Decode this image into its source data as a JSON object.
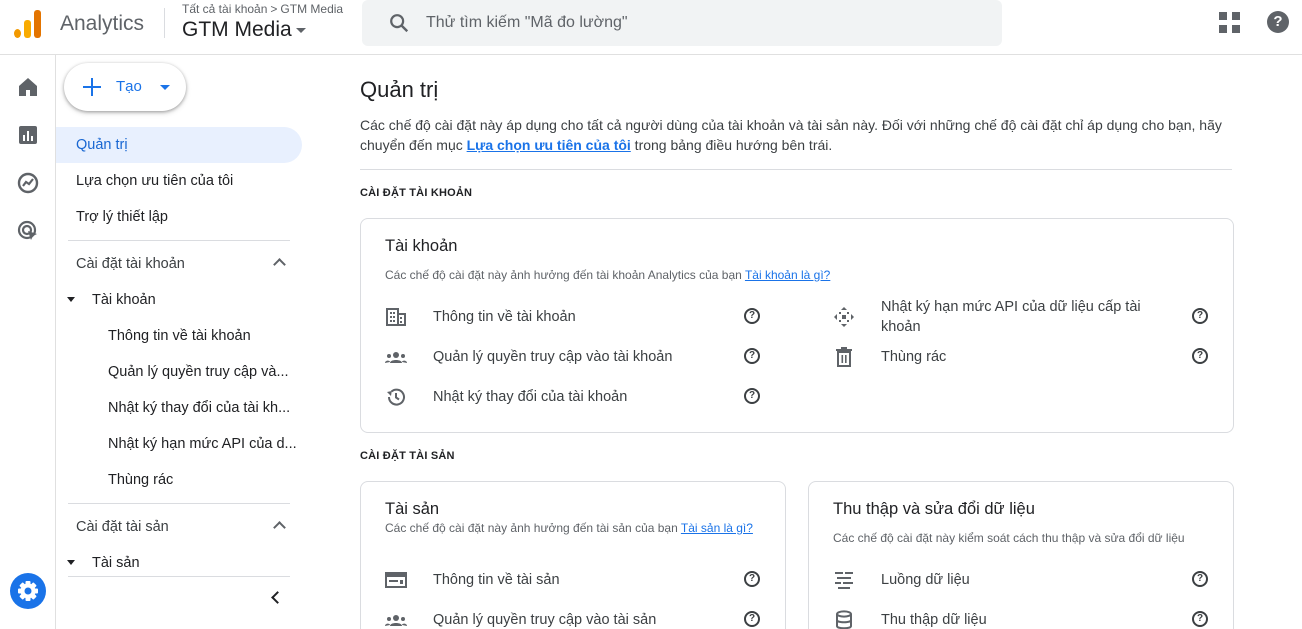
{
  "app": {
    "name": "Analytics"
  },
  "header": {
    "breadcrumb_root": "Tất cả tài khoản",
    "breadcrumb_sep": ">",
    "breadcrumb_account": "GTM Media",
    "account_name": "GTM Media",
    "search_placeholder": "Thử tìm kiếm \"Mã đo lường\"",
    "help_glyph": "?"
  },
  "sidebar": {
    "create_label": "Tạo",
    "items": [
      "Quản trị",
      "Lựa chọn ưu tiên của tôi",
      "Trợ lý thiết lập"
    ],
    "account_section": "Cài đặt tài khoản",
    "account_group": "Tài khoản",
    "account_leaves": [
      "Thông tin về tài khoản",
      "Quản lý quyền truy cập và...",
      "Nhật ký thay đổi của tài kh...",
      "Nhật ký hạn mức API của d...",
      "Thùng rác"
    ],
    "property_section": "Cài đặt tài sản",
    "property_group": "Tài sản"
  },
  "main": {
    "title": "Quản trị",
    "desc_before": "Các chế độ cài đặt này áp dụng cho tất cả người dùng của tài khoản và tài sản này. Đối với những chế độ cài đặt chỉ áp dụng cho bạn, hãy chuyển đến mục ",
    "desc_link": "Lựa chọn ưu tiên của tôi",
    "desc_after": " trong bảng điều hướng bên trái.",
    "account_settings_label": "CÀI ĐẶT TÀI KHOẢN",
    "property_settings_label": "CÀI ĐẶT TÀI SẢN",
    "account_card": {
      "title": "Tài khoản",
      "desc": "Các chế độ cài đặt này ảnh hưởng đến tài khoản Analytics của bạn ",
      "link": "Tài khoản là gì?",
      "rows": [
        "Thông tin về tài khoản",
        "Quản lý quyền truy cập vào tài khoản",
        "Nhật ký thay đổi của tài khoản",
        "Nhật ký hạn mức API của dữ liệu cấp tài khoản",
        "Thùng rác"
      ]
    },
    "property_card": {
      "title": "Tài sản",
      "desc": "Các chế độ cài đặt này ảnh hưởng đến tài sản của bạn ",
      "link": "Tài sản là gì?",
      "rows": [
        "Thông tin về tài sản",
        "Quản lý quyền truy cập vào tài sản"
      ]
    },
    "data_card": {
      "title": "Thu thập và sửa đổi dữ liệu",
      "desc": "Các chế độ cài đặt này kiểm soát cách thu thập và sửa đổi dữ liệu",
      "rows": [
        "Luồng dữ liệu",
        "Thu thập dữ liệu"
      ]
    }
  },
  "colors": {
    "accent": "#1a73e8",
    "active_bg": "#e8f0fe",
    "logo_orange": "#e37400",
    "logo_yellow": "#f9ab00"
  }
}
